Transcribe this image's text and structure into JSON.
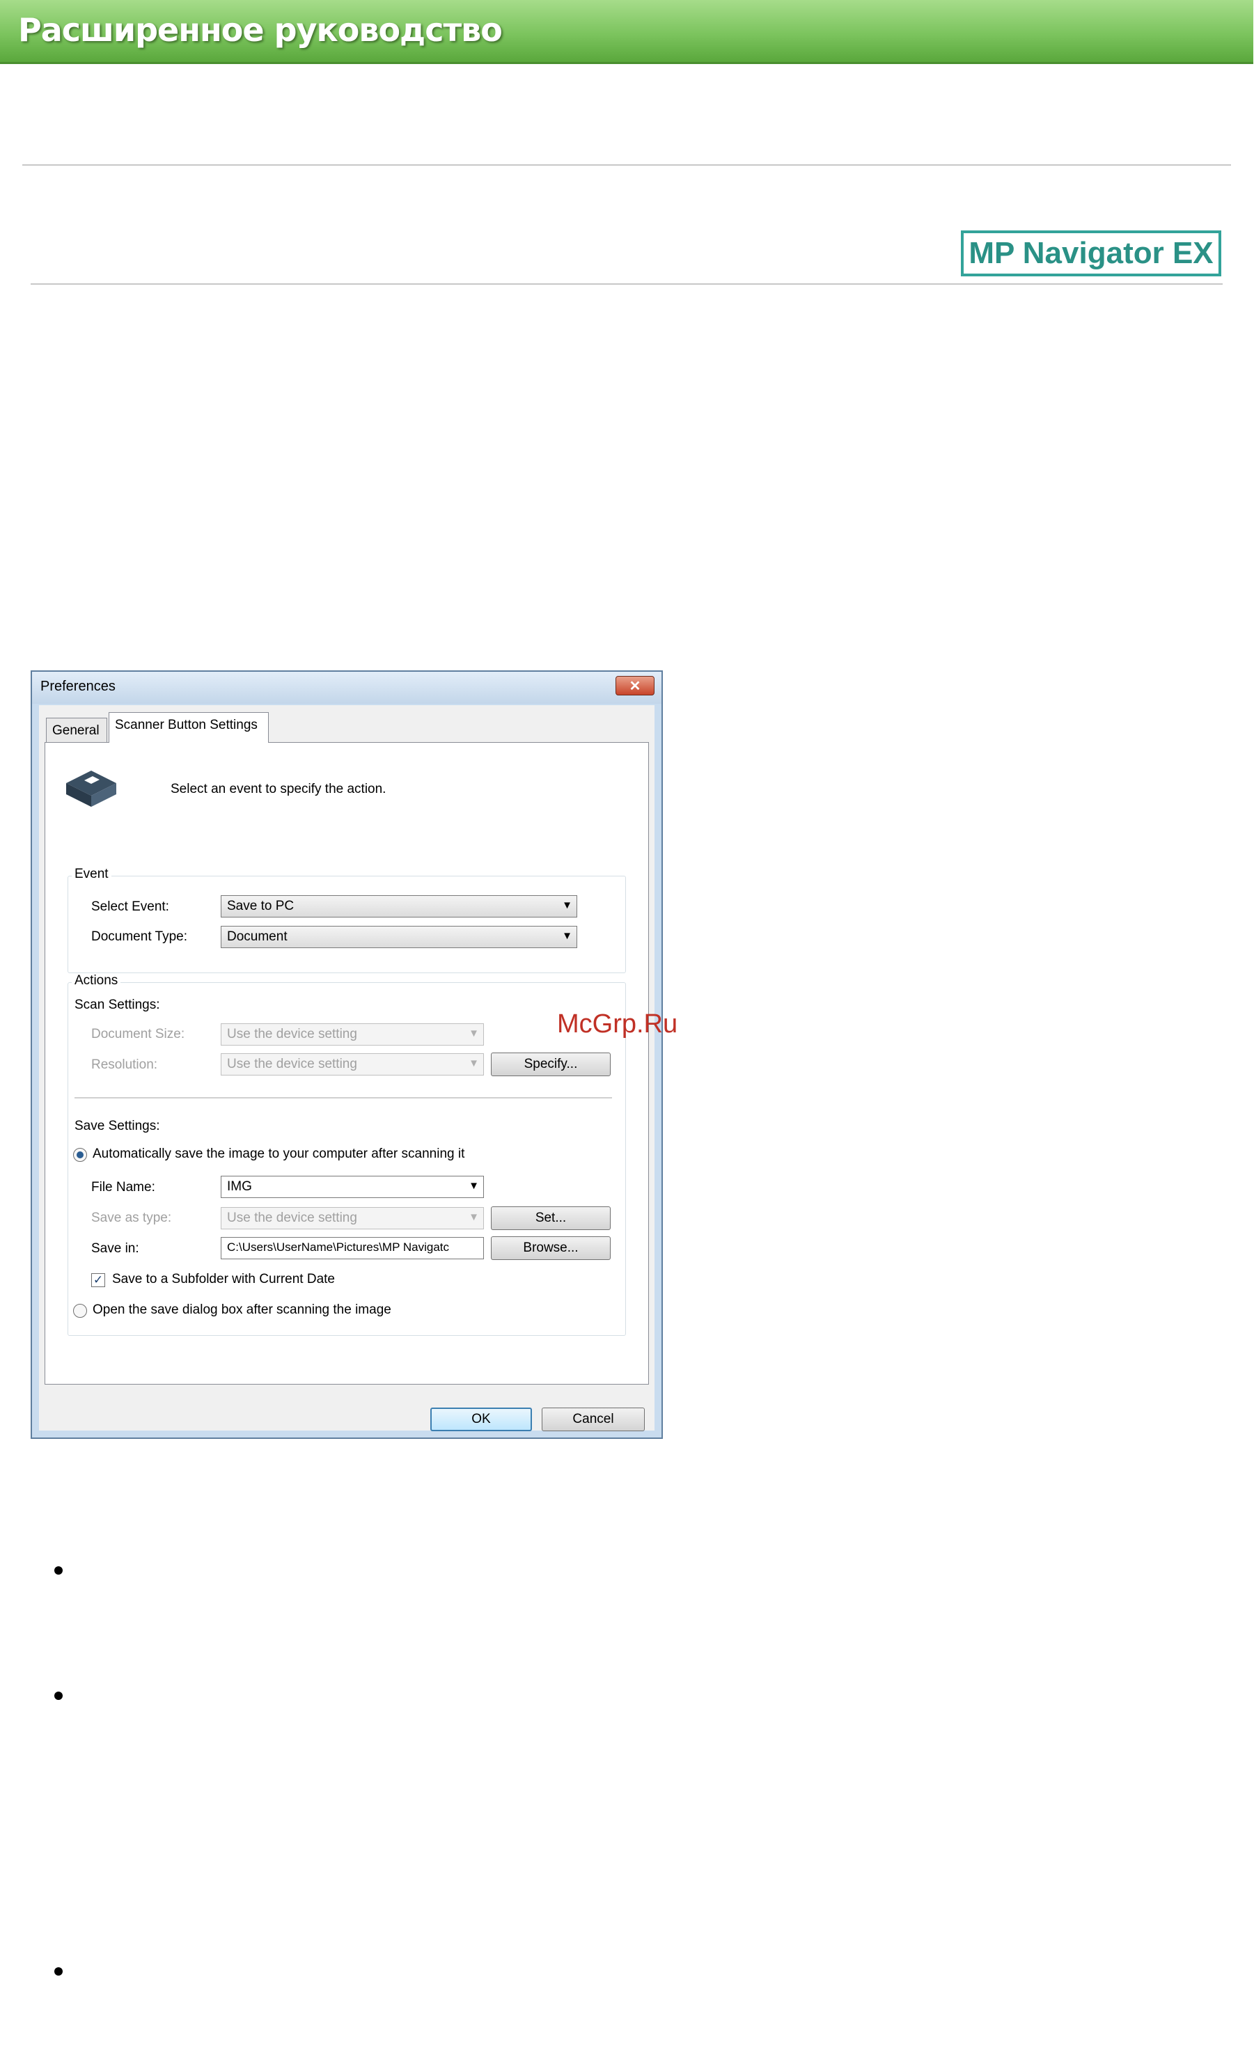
{
  "header": {
    "title": "Расширенное руководство"
  },
  "badge": {
    "label": "MP Navigator EX"
  },
  "dialog": {
    "title": "Preferences",
    "close_glyph": "✕",
    "tabs": [
      "General",
      "Scanner Button Settings"
    ],
    "hint": "Select an event to specify the action.",
    "event": {
      "group_label": "Event",
      "select_event_label": "Select Event:",
      "select_event_value": "Save to PC",
      "document_type_label": "Document Type:",
      "document_type_value": "Document"
    },
    "actions": {
      "group_label": "Actions",
      "scan_settings_label": "Scan Settings:",
      "document_size_label": "Document Size:",
      "document_size_value": "Use the device setting",
      "resolution_label": "Resolution:",
      "resolution_value": "Use the device setting",
      "specify_button": "Specify...",
      "save_settings_label": "Save Settings:",
      "auto_save_label": "Automatically save the image to your computer after scanning it",
      "file_name_label": "File Name:",
      "file_name_value": "IMG",
      "save_as_type_label": "Save as type:",
      "save_as_type_value": "Use the device setting",
      "set_button": "Set...",
      "save_in_label": "Save in:",
      "save_in_value": "C:\\Users\\UserName\\Pictures\\MP Navigatc",
      "browse_button": "Browse...",
      "subfolder_label": "Save to a Subfolder with Current Date",
      "open_dialog_label": "Open the save dialog box after scanning the image"
    },
    "ok_button": "OK",
    "cancel_button": "Cancel",
    "dropdown_glyph": "▼"
  },
  "watermark": {
    "text": "McGrp.Ru"
  },
  "colors": {
    "banner": "#7cc45e",
    "badge": "#33a39a",
    "watermark": "#c03025"
  }
}
